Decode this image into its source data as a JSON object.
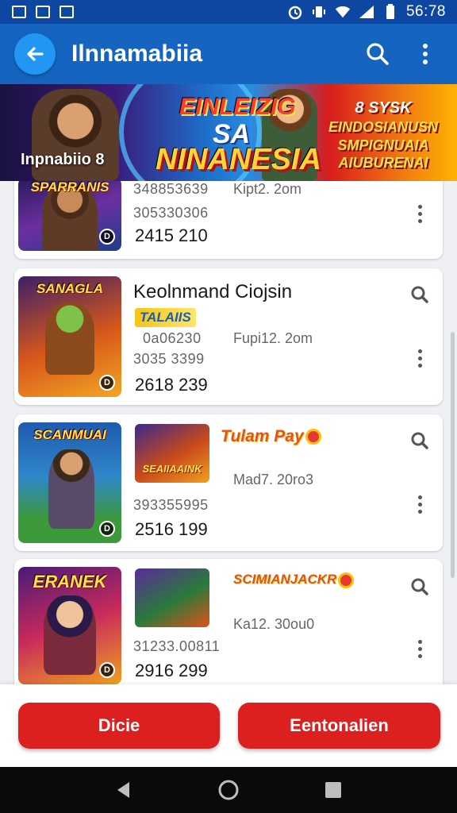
{
  "status_bar": {
    "time": "56:78"
  },
  "app_bar": {
    "title": "Ilnnamabiia"
  },
  "banner": {
    "caption": "Inpnabiio 8",
    "headline_1": "EINLEIZIG",
    "headline_2": "SA",
    "headline_3": "NINANESIA",
    "promo": [
      "8 SYSK",
      "EINDOSIANUSN",
      "SMPIGNUAIA",
      "AIUBURENAI"
    ]
  },
  "cards": [
    {
      "thumb_title": "SPARRANIS",
      "meta_left": "348853639",
      "meta_right": "Kipt2. 2om",
      "meta_line2": "305330306",
      "price": "2415 210"
    },
    {
      "thumb_title": "SANAGLA",
      "title": "Keolnmand Ciojsin",
      "logo": "TALAIIS",
      "meta_left": "0a06230",
      "meta_right": "Fupi12. 2om",
      "meta_line2": "3035 3399",
      "price": "2618 239"
    },
    {
      "thumb_title": "SCANMUAI",
      "mini_title": "SEAIIAAINK",
      "logo": "Tulam Pay",
      "meta_right": "Mad7. 20ro3",
      "meta_line2": "393355995",
      "price": "2516 199"
    },
    {
      "thumb_title": "ERANEK",
      "logo": "SCIMIANJACKR",
      "meta_right": "Ka12. 30ou0",
      "meta_line2": "31233.00811",
      "price": "2916 299"
    }
  ],
  "actions": {
    "primary": "Dicie",
    "secondary": "Eentonalien"
  },
  "colors": {
    "app_bar": "#1565c0",
    "status_bar": "#0d47a1",
    "accent_button": "#dc1f1f",
    "back_button": "#2196f3"
  }
}
